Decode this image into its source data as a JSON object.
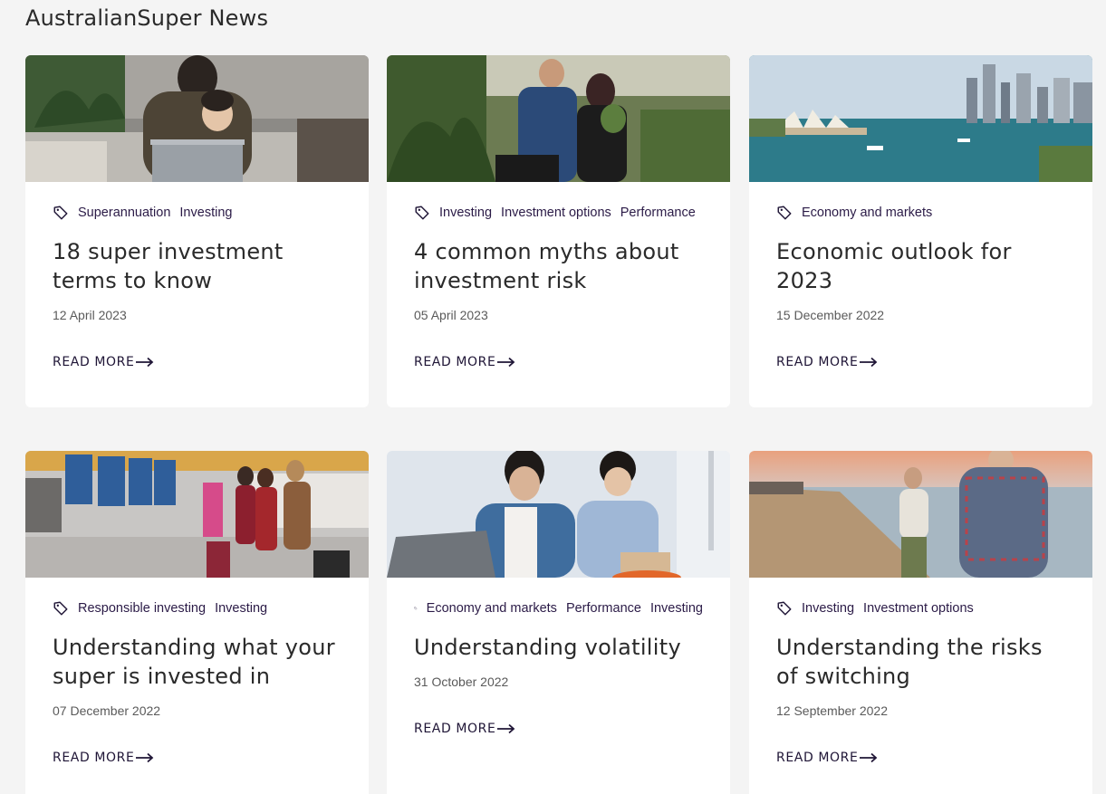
{
  "page": {
    "title": "AustralianSuper News"
  },
  "cards": [
    {
      "image": "parent-and-child-with-laptop-photo",
      "tags": [
        "Superannuation",
        "Investing"
      ],
      "title": "18 super investment terms to know",
      "date": "12 April 2023",
      "cta": "READ MORE"
    },
    {
      "image": "couple-in-garden-nursery-photo",
      "tags": [
        "Investing",
        "Investment options",
        "Performance"
      ],
      "title": "4 common myths about investment risk",
      "date": "05 April 2023",
      "cta": "READ MORE"
    },
    {
      "image": "sydney-harbour-photo",
      "tags": [
        "Economy and markets"
      ],
      "title": "Economic outlook for 2023",
      "date": "15 December 2022",
      "cta": "READ MORE"
    },
    {
      "image": "travellers-in-airport-photo",
      "tags": [
        "Responsible investing",
        "Investing"
      ],
      "title": "Understanding what your super is invested in",
      "date": "07 December 2022",
      "cta": "READ MORE"
    },
    {
      "image": "father-and-son-with-laptop-photo",
      "tags": [
        "Economy and markets",
        "Performance",
        "Investing"
      ],
      "title": "Understanding volatility",
      "date": "31 October 2022",
      "cta": "READ MORE"
    },
    {
      "image": "couple-on-beach-at-sunset-photo",
      "tags": [
        "Investing",
        "Investment options"
      ],
      "title": "Understanding the risks of switching",
      "date": "12 September 2022",
      "cta": "READ MORE"
    }
  ]
}
